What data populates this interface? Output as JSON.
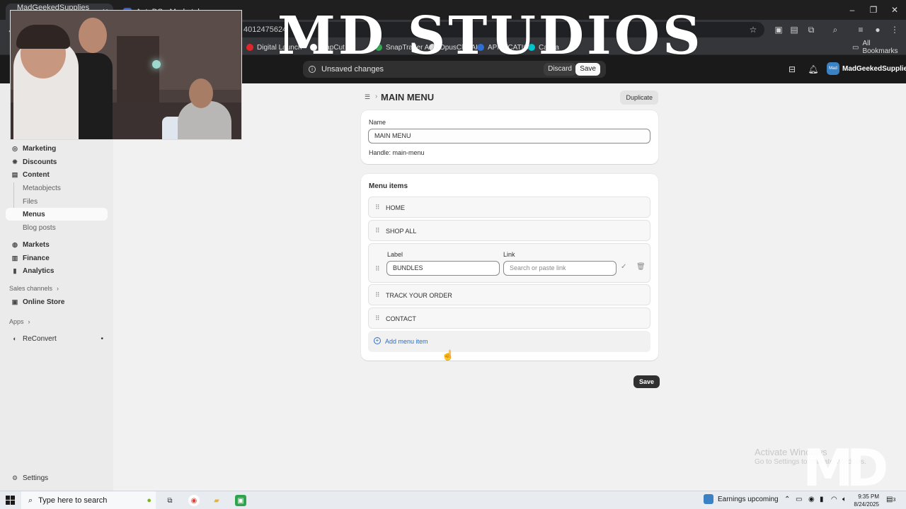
{
  "browser": {
    "tabs": [
      {
        "label": "MadGeekedSupplies · Menus",
        "active": true
      },
      {
        "label": "AutoDS - Marketplace",
        "active": false
      }
    ],
    "address_fragment": "4012475624",
    "bookmarks": [
      {
        "label": "Digital Launch",
        "color": "#e0262b"
      },
      {
        "label": "CapCut",
        "color": "#ffffff"
      },
      {
        "label": "",
        "color": "#ea4335"
      },
      {
        "label": "SnapTrader A",
        "color": "#34a853"
      },
      {
        "label": "OpusClip-AI",
        "color": "#dcdcdc"
      },
      {
        "label": "APPLICATIO",
        "color": "#2f6fd1"
      },
      {
        "label": "Canva",
        "color": "#00c4cc"
      }
    ],
    "all_bookmarks_label": "All Bookmarks"
  },
  "admin_bar": {
    "unsaved_text": "Unsaved changes",
    "discard_label": "Discard",
    "save_label": "Save",
    "store_name": "MadGeekedSupplies",
    "store_avatar_text": "Mad"
  },
  "sidebar": {
    "items": [
      {
        "label": "Marketing",
        "icon": "target-icon"
      },
      {
        "label": "Discounts",
        "icon": "discount-icon"
      },
      {
        "label": "Content",
        "icon": "content-icon"
      }
    ],
    "content_sub": [
      {
        "label": "Metaobjects"
      },
      {
        "label": "Files"
      },
      {
        "label": "Menus",
        "active": true
      },
      {
        "label": "Blog posts"
      }
    ],
    "items2": [
      {
        "label": "Markets",
        "icon": "globe-icon"
      },
      {
        "label": "Finance",
        "icon": "bank-icon"
      },
      {
        "label": "Analytics",
        "icon": "chart-icon"
      }
    ],
    "sales_channels_label": "Sales channels",
    "online_store_label": "Online Store",
    "apps_label": "Apps",
    "reconvert_label": "ReConvert",
    "settings_label": "Settings"
  },
  "page": {
    "title": "MAIN MENU",
    "duplicate_label": "Duplicate",
    "name_label": "Name",
    "name_value": "MAIN MENU",
    "handle_text": "Handle: main-menu",
    "menu_items_title": "Menu items",
    "menu_items_before": [
      "HOME",
      "SHOP ALL"
    ],
    "edit_row": {
      "label_caption": "Label",
      "link_caption": "Link",
      "label_value": "BUNDLES",
      "link_placeholder": "Search or paste link"
    },
    "menu_items_after": [
      "TRACK YOUR ORDER",
      "CONTACT"
    ],
    "add_item_label": "Add menu item",
    "save_label": "Save"
  },
  "overlay": {
    "activate_title": "Activate Windows",
    "activate_sub": "Go to Settings to activate Windows.",
    "watermark_top": "MD STUDIOS",
    "watermark_corner": "MD"
  },
  "taskbar": {
    "search_placeholder": "Type here to search",
    "news_label": "Earnings upcoming",
    "time": "9:35 PM",
    "date": "8/24/2025",
    "notification_count": "3"
  }
}
